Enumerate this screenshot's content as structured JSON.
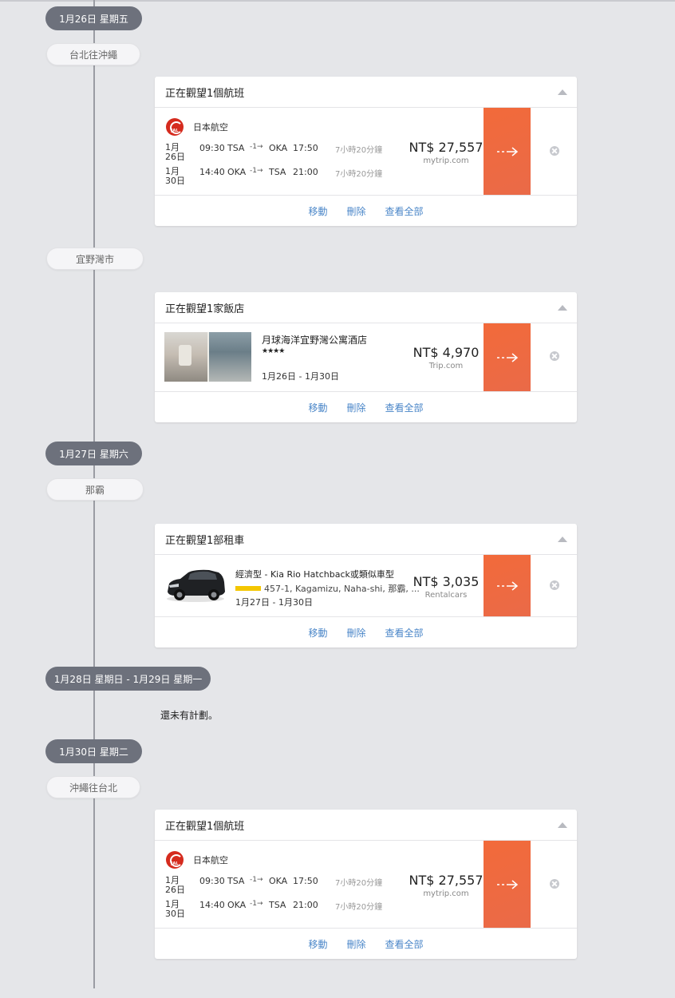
{
  "days": [
    {
      "date": "1月26日 星期五"
    },
    {
      "date": "1月27日 星期六"
    },
    {
      "date": "1月28日 星期日 - 1月29日 星期一",
      "empty_text": "還未有計劃。"
    },
    {
      "date": "1月30日 星期二"
    }
  ],
  "places": [
    "台北往沖繩",
    "宜野灣市",
    "那霸",
    "沖繩往台北"
  ],
  "footer": {
    "move": "移動",
    "delete": "刪除",
    "view_all": "查看全部"
  },
  "flight1": {
    "header": "正在觀望1個航班",
    "airline": "日本航空",
    "legs": [
      {
        "date": "1月26日",
        "dep_time": "09:30",
        "dep_airport": "TSA",
        "stops": "-1→",
        "arr_airport": "OKA",
        "arr_time": "17:50",
        "duration": "7小時20分鐘"
      },
      {
        "date": "1月30日",
        "dep_time": "14:40",
        "dep_airport": "OKA",
        "stops": "-1→",
        "arr_airport": "TSA",
        "arr_time": "21:00",
        "duration": "7小時20分鐘"
      }
    ],
    "price": "NT$ 27,557",
    "source": "mytrip.com"
  },
  "hotel": {
    "header": "正在觀望1家飯店",
    "name": "月球海洋宜野灣公寓酒店",
    "stars": "★★★★",
    "dates": "1月26日 - 1月30日",
    "price": "NT$ 4,970",
    "source": "Trip.com"
  },
  "car": {
    "header": "正在觀望1部租車",
    "name": "經濟型 - Kia Rio Hatchback或類似車型",
    "location": "457-1, Kagamizu, Naha-shi, 那霸, ...",
    "dates": "1月27日 - 1月30日",
    "price": "NT$ 3,035",
    "source": "Rentalcars"
  },
  "flight2": {
    "header": "正在觀望1個航班",
    "airline": "日本航空",
    "legs": [
      {
        "date": "1月26日",
        "dep_time": "09:30",
        "dep_airport": "TSA",
        "stops": "-1→",
        "arr_airport": "OKA",
        "arr_time": "17:50",
        "duration": "7小時20分鐘"
      },
      {
        "date": "1月30日",
        "dep_time": "14:40",
        "dep_airport": "OKA",
        "stops": "-1→",
        "arr_airport": "TSA",
        "arr_time": "21:00",
        "duration": "7小時20分鐘"
      }
    ],
    "price": "NT$ 27,557",
    "source": "mytrip.com"
  },
  "icons": {
    "go": "arrow-right-icon",
    "remove": "close-circle-icon",
    "collapse": "caret-up-icon",
    "airline": "jal-logo-icon"
  },
  "colors": {
    "accent": "#f26a3a",
    "link": "#4a86c8",
    "date_pill": "#6d717c",
    "background": "#e5e6e9"
  }
}
